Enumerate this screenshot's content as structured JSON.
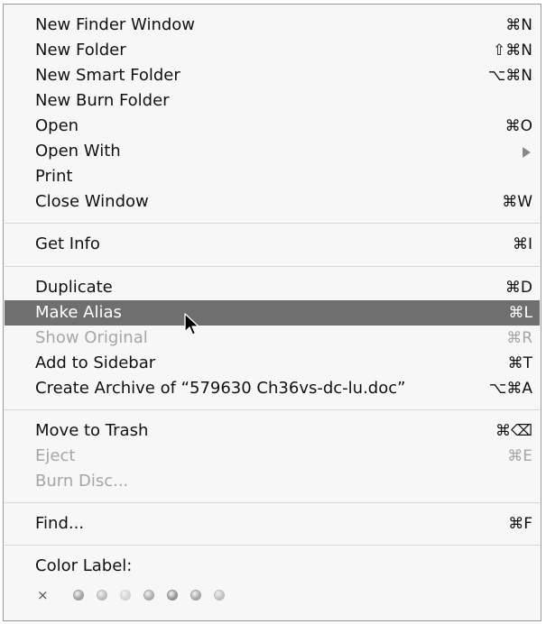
{
  "menu": {
    "items": [
      {
        "label": "New Finder Window",
        "shortcut": "⌘N"
      },
      {
        "label": "New Folder",
        "shortcut": "⇧⌘N"
      },
      {
        "label": "New Smart Folder",
        "shortcut": "⌥⌘N"
      },
      {
        "label": "New Burn Folder",
        "shortcut": ""
      },
      {
        "label": "Open",
        "shortcut": "⌘O"
      },
      {
        "label": "Open With",
        "shortcut": ""
      },
      {
        "label": "Print",
        "shortcut": ""
      },
      {
        "label": "Close Window",
        "shortcut": "⌘W"
      },
      {
        "label": "Get Info",
        "shortcut": "⌘I"
      },
      {
        "label": "Duplicate",
        "shortcut": "⌘D"
      },
      {
        "label": "Make Alias",
        "shortcut": "⌘L"
      },
      {
        "label": "Show Original",
        "shortcut": "⌘R"
      },
      {
        "label": "Add to Sidebar",
        "shortcut": "⌘T"
      },
      {
        "label": "Create Archive of “579630 Ch36vs-dc-lu.doc”",
        "shortcut": "⌥⌘A"
      },
      {
        "label": "Move to Trash",
        "shortcut": "⌘⌫"
      },
      {
        "label": "Eject",
        "shortcut": "⌘E"
      },
      {
        "label": "Burn Disc...",
        "shortcut": ""
      },
      {
        "label": "Find...",
        "shortcut": "⌘F"
      }
    ],
    "color_label": {
      "title": "Color Label:",
      "none_symbol": "×",
      "colors": [
        "#9c9c9c",
        "#b9b9b9",
        "#d2d2d2",
        "#a8a8a8",
        "#8e8e8e",
        "#a2a2a2",
        "#bdbdbd"
      ]
    },
    "highlight_color": "#6f6f6f",
    "disabled_color": "#a6a6a6"
  }
}
